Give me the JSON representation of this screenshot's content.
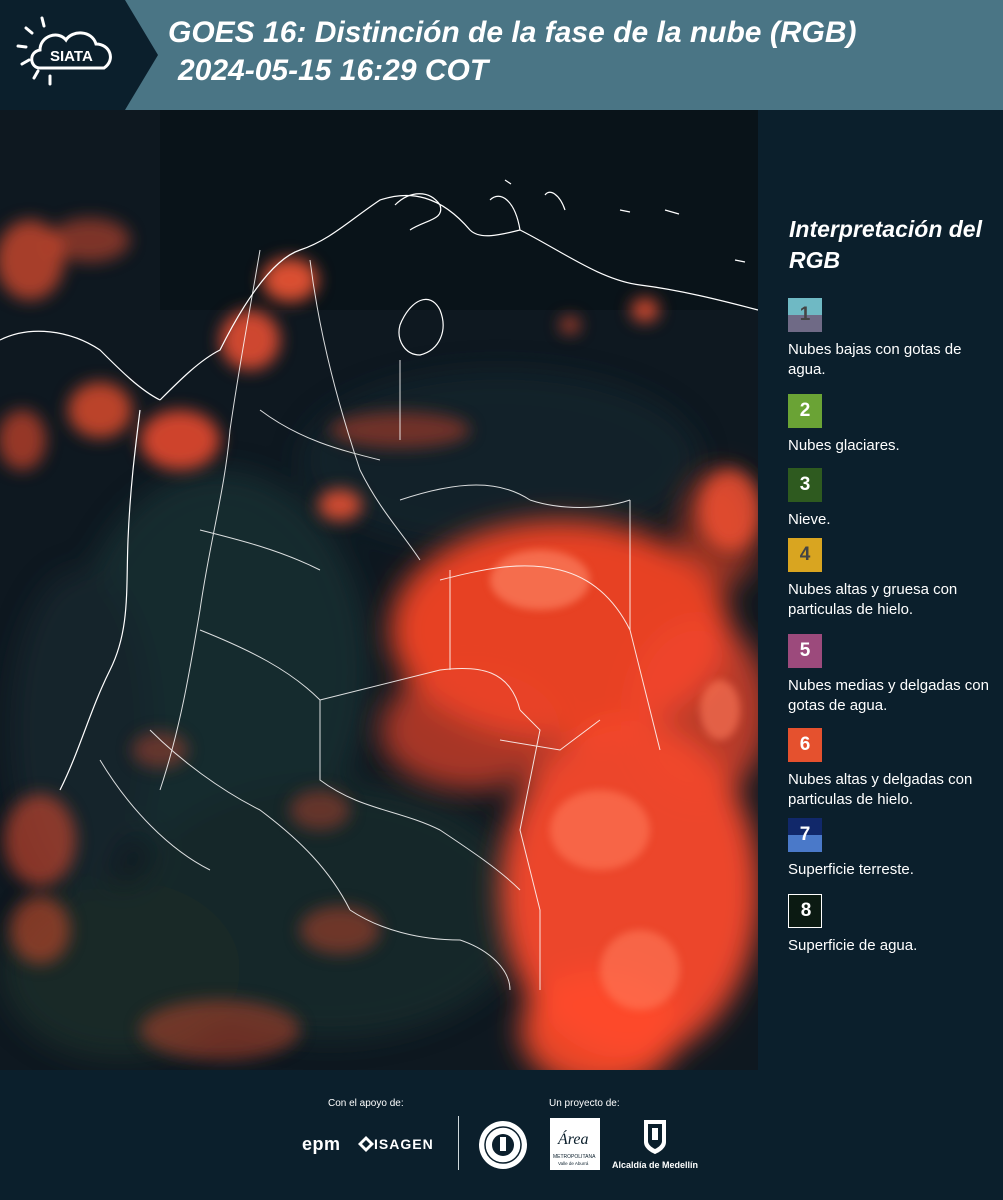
{
  "header": {
    "logo_text": "SIATA",
    "title_line1": "GOES 16: Distinción de la fase de la nube (RGB)",
    "title_line2": "2024-05-15 16:29 COT"
  },
  "legend": {
    "title": "Interpretación del RGB",
    "items": [
      {
        "number": "1",
        "label": "Nubes bajas con gotas de agua.",
        "color_top": "#6fb9c4",
        "color_bottom": "#6f6a86",
        "num_color": "#444444"
      },
      {
        "number": "2",
        "label": "Nubes glaciares.",
        "color_top": "#6aa335",
        "color_bottom": "#6aa335",
        "num_color": "#ffffff"
      },
      {
        "number": "3",
        "label": "Nieve.",
        "color_top": "#2e5a1f",
        "color_bottom": "#2e5a1f",
        "num_color": "#ffffff"
      },
      {
        "number": "4",
        "label": "Nubes altas y gruesa con particulas de hielo.",
        "color_top": "#d9a520",
        "color_bottom": "#d9a520",
        "num_color": "#444444"
      },
      {
        "number": "5",
        "label": "Nubes medias y delgadas con gotas de agua.",
        "color_top": "#9c4a7c",
        "color_bottom": "#9c4a7c",
        "num_color": "#ffffff"
      },
      {
        "number": "6",
        "label": "Nubes altas y delgadas con particulas de hielo.",
        "color_top": "#e5512e",
        "color_bottom": "#e5512e",
        "num_color": "#ffffff"
      },
      {
        "number": "7",
        "label": "Superficie terreste.",
        "color_top": "#11286a",
        "color_bottom": "#4a79c9",
        "num_color": "#ffffff"
      },
      {
        "number": "8",
        "label": "Superficie de agua.",
        "color_top": "#0b1a12",
        "color_bottom": "#0b1a12",
        "num_color": "#ffffff"
      }
    ]
  },
  "footer": {
    "support_label": "Con el apoyo de:",
    "project_label": "Un proyecto de:",
    "epm": "epm",
    "isagen": "ISAGEN",
    "area_metro": "Área",
    "area_sub1": "METROPOLITANA",
    "area_sub2": "Valle de Aburrá",
    "alcaldia": "Alcaldía de Medellín"
  },
  "colors": {
    "header_bg": "#4a7585",
    "panel_bg": "#0b1f2c",
    "cloud_ice": "#ff4a2a",
    "land_dark": "#14242c",
    "border_line": "#ffffff"
  }
}
